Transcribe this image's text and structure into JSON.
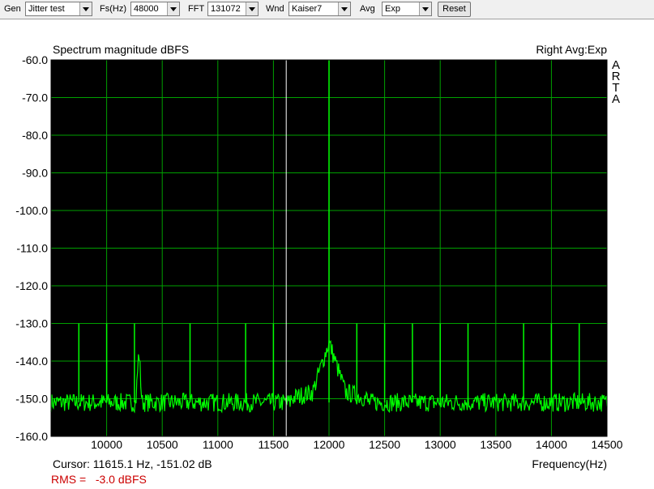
{
  "toolbar": {
    "gen_label": "Gen",
    "gen_value": "Jitter test",
    "fs_label": "Fs(Hz)",
    "fs_value": "48000",
    "fft_label": "FFT",
    "fft_value": "131072",
    "wnd_label": "Wnd",
    "wnd_value": "Kaiser7",
    "avg_label": "Avg",
    "avg_value": "Exp",
    "reset_label": "Reset"
  },
  "chart": {
    "title": "Spectrum magnitude dBFS",
    "subtitle": "Right Avg:Exp",
    "brand_letters": [
      "A",
      "R",
      "T",
      "A"
    ],
    "cursor_text": "Cursor: 11615.1 Hz, -151.02 dB",
    "rms_text": "RMS =   -3.0 dBFS"
  },
  "chart_data": {
    "type": "line",
    "title": "Spectrum magnitude dBFS",
    "xlabel": "Frequency(Hz)",
    "ylabel": "",
    "xlim": [
      9500,
      14500
    ],
    "ylim": [
      -160,
      -60
    ],
    "x_ticks": [
      10000,
      10500,
      11000,
      11500,
      12000,
      12500,
      13000,
      13500,
      14000,
      14500
    ],
    "y_ticks": [
      -60,
      -70,
      -80,
      -90,
      -100,
      -110,
      -120,
      -130,
      -140,
      -150,
      -160
    ],
    "x_tick_labels": [
      "10000",
      "10500",
      "11000",
      "11500",
      "12000",
      "12500",
      "13000",
      "13500",
      "14000",
      "14500"
    ],
    "y_tick_labels": [
      "-60.0",
      "-70.0",
      "-80.0",
      "-90.0",
      "-100.0",
      "-110.0",
      "-120.0",
      "-130.0",
      "-140.0",
      "-150.0",
      "-160.0"
    ],
    "grid": true,
    "noise_floor_db": -151,
    "main_tone": {
      "freq_hz": 12000,
      "level_db": -60
    },
    "main_tone_skirt_peak_db": -135,
    "sideband_spurs": [
      {
        "freq_hz": 9750,
        "level_db": -130
      },
      {
        "freq_hz": 10000,
        "level_db": -130
      },
      {
        "freq_hz": 10250,
        "level_db": -130
      },
      {
        "freq_hz": 10750,
        "level_db": -130
      },
      {
        "freq_hz": 11250,
        "level_db": -130
      },
      {
        "freq_hz": 11500,
        "level_db": -130
      },
      {
        "freq_hz": 12250,
        "level_db": -130
      },
      {
        "freq_hz": 12500,
        "level_db": -130
      },
      {
        "freq_hz": 12750,
        "level_db": -130
      },
      {
        "freq_hz": 13000,
        "level_db": -130
      },
      {
        "freq_hz": 13250,
        "level_db": -130
      },
      {
        "freq_hz": 13750,
        "level_db": -130
      },
      {
        "freq_hz": 14000,
        "level_db": -130
      },
      {
        "freq_hz": 14250,
        "level_db": -130
      }
    ],
    "secondary_peak": {
      "freq_hz": 10290,
      "level_db": -137
    },
    "cursor": {
      "freq_hz": 11615.1,
      "level_db": -151.02
    },
    "colors": {
      "background": "#000000",
      "grid": "#00a000",
      "trace": "#00ff00",
      "cursor": "#ffffff",
      "rms_text": "#cc0000"
    }
  }
}
